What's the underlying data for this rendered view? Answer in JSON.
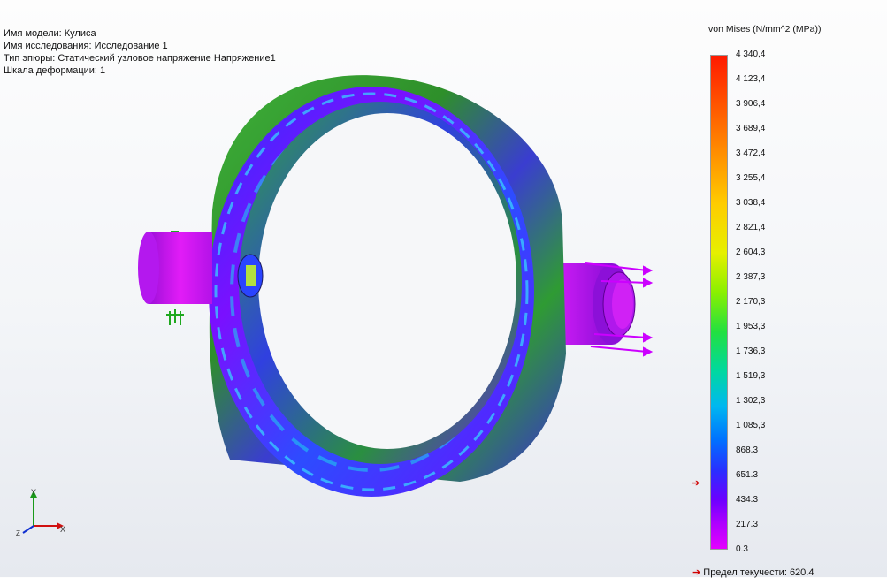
{
  "info": {
    "model": "Имя модели: Кулиса",
    "study": "Имя исследования: Исследование 1",
    "plot_type": "Тип эпюры: Статический узловое напряжение Напряжение1",
    "deform_scale": "Шкала деформации: 1"
  },
  "legend": {
    "title": "von Mises (N/mm^2 (MPa))",
    "ticks": [
      "4 340,4",
      "4 123,4",
      "3 906,4",
      "3 689,4",
      "3 472,4",
      "3 255,4",
      "3 038,4",
      "2 821,4",
      "2 604,3",
      "2 387,3",
      "2 170,3",
      "1 953,3",
      "1 736,3",
      "1 519,3",
      "1 302,3",
      "1 085,3",
      "868.3",
      "651.3",
      "434.3",
      "217.3",
      "0.3"
    ],
    "yield_marker": "➔",
    "yield_label": "Предел текучести: 620.4",
    "colors": {
      "max": "#ff1a00",
      "min": "#e400ff"
    }
  },
  "triad": {
    "y": "Y",
    "x": "X",
    "z": "Z"
  },
  "model_view": {
    "part": "Кулиса",
    "colors": {
      "ring_outer": "#3ca01e",
      "ring_face": "#3a2cff",
      "shaft": "#c016ee",
      "loads": "#cc00ff",
      "fixtures": "#1fa81f"
    }
  }
}
